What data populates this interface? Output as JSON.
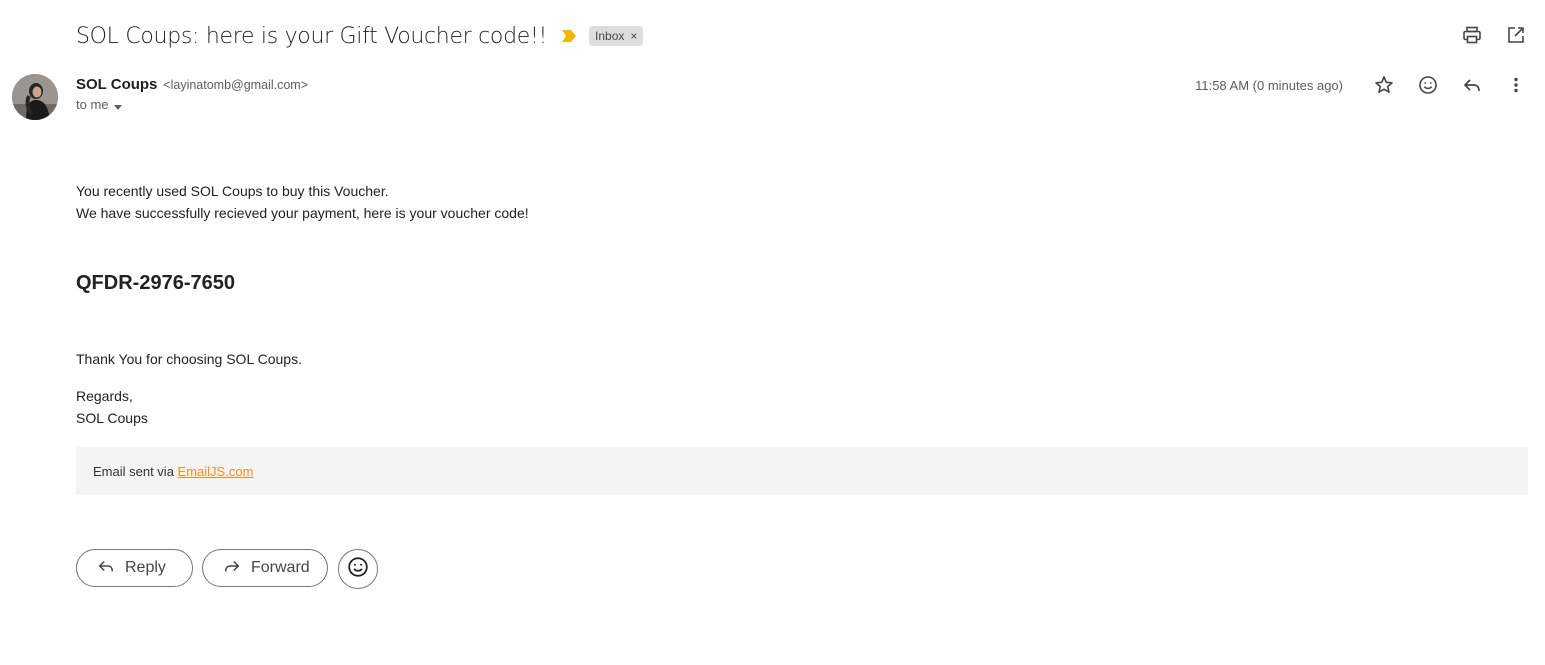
{
  "subject": {
    "title": "SOL Coups: here is your Gift Voucher code!!",
    "label": "Inbox",
    "label_remove": "×",
    "importance_color": "#f4b400"
  },
  "toolbar": {
    "print_icon": "print-icon",
    "open_new_window_icon": "open-in-new-window-icon"
  },
  "sender": {
    "name": "SOL Coups",
    "email": "<layinatomb@gmail.com>",
    "to_label": "to me"
  },
  "meta": {
    "timestamp": "11:58 AM (0 minutes ago)"
  },
  "body": {
    "line1": "You recently used SOL Coups to buy this Voucher.",
    "line2": "We have successfully recieved your payment, here is your voucher code!",
    "voucher_code": "QFDR-2976-7650",
    "thanks": "Thank You for choosing SOL Coups.",
    "regards": "Regards,",
    "signature": "SOL Coups"
  },
  "footer": {
    "prefix": "Email sent via ",
    "link_text": "EmailJS.com",
    "link_color": "#f28c28"
  },
  "actions": {
    "reply_label": "Reply",
    "forward_label": "Forward"
  }
}
